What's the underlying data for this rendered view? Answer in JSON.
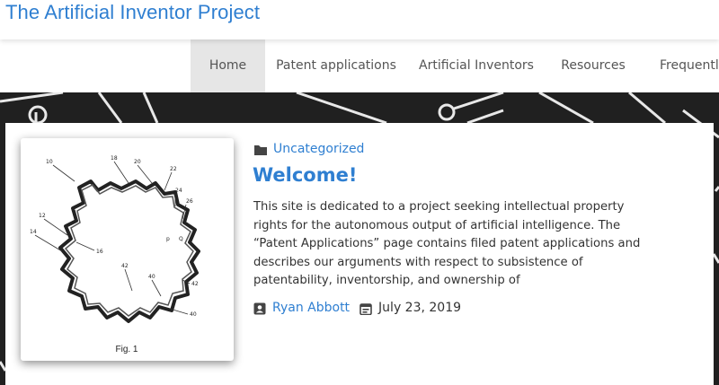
{
  "site": {
    "title": "The Artificial Inventor Project"
  },
  "nav": {
    "items": [
      {
        "label": "Home",
        "active": true
      },
      {
        "label": "Patent applications",
        "active": false
      },
      {
        "label": "Artificial Inventors",
        "active": false
      },
      {
        "label": "Resources",
        "active": false
      },
      {
        "label": "Frequently",
        "active": false
      }
    ]
  },
  "post": {
    "category": "Uncategorized",
    "category_icon": "folder-icon",
    "title": "Welcome!",
    "excerpt": "This site is dedicated to a project seeking intellectual property rights for the autonomous output of artificial intelligence. The “Patent Applications” page contains filed patent applications and describes our arguments with respect to subsistence of patentability, inventorship, and ownership of",
    "author": "Ryan Abbott",
    "author_icon": "account-box-icon",
    "date": "July 23, 2019",
    "date_icon": "calendar-icon",
    "thumbnail": {
      "caption": "Fig. 1",
      "labels": [
        "10",
        "18",
        "20",
        "22",
        "24",
        "26",
        "12",
        "14",
        "16",
        "42",
        "40",
        "42",
        "40",
        "p",
        "Q"
      ]
    }
  },
  "colors": {
    "accent": "#2f7fd1",
    "hero_background": "#202020",
    "nav_active_background": "#e6e6e6"
  }
}
